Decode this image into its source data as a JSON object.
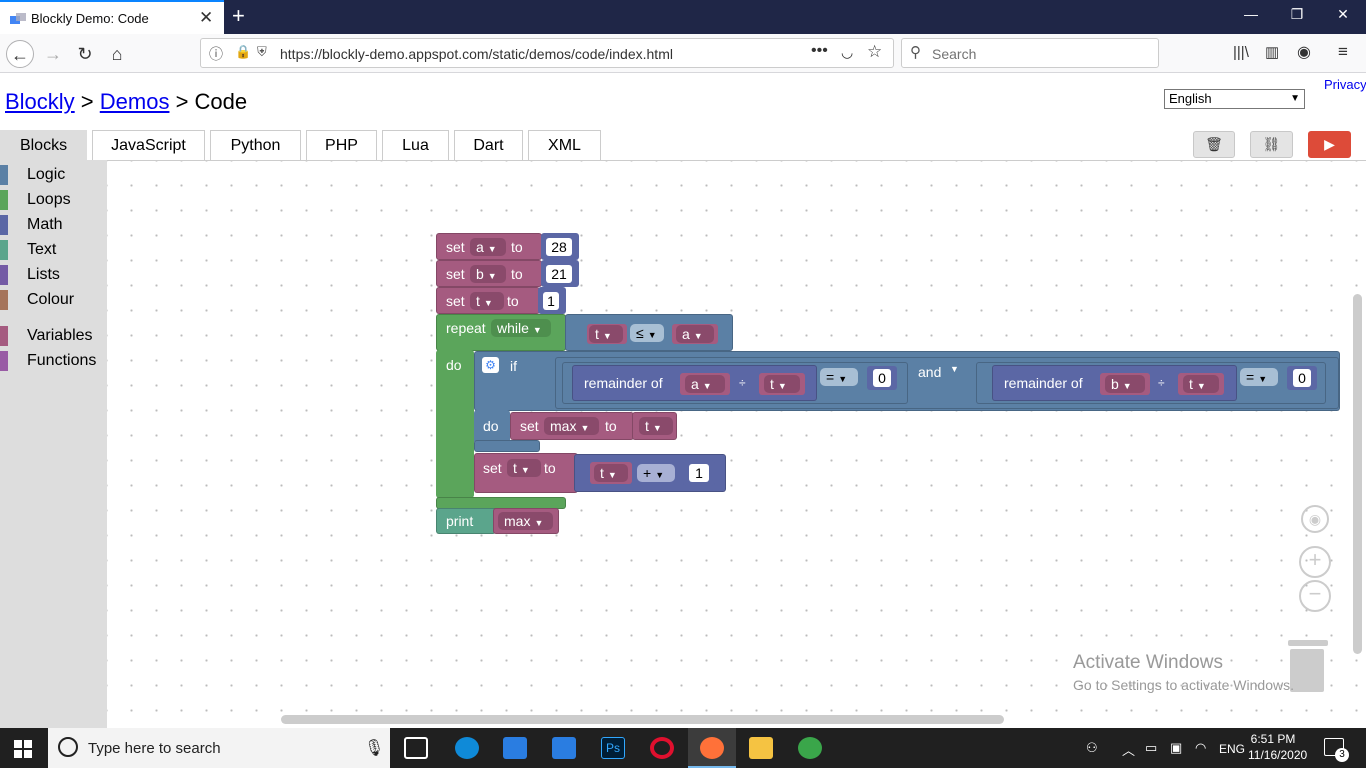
{
  "browser": {
    "tab_title": "Blockly Demo: Code",
    "url": "https://blockly-demo.appspot.com/static/demos/code/index.html",
    "search_placeholder": "Search"
  },
  "header": {
    "breadcrumb_blockly": "Blockly",
    "sep1": " > ",
    "breadcrumb_demos": "Demos",
    "sep2": " > ",
    "breadcrumb_current": "Code",
    "privacy": "Privacy",
    "language": "English"
  },
  "tabs": [
    "Blocks",
    "JavaScript",
    "Python",
    "PHP",
    "Lua",
    "Dart",
    "XML"
  ],
  "toolbox": [
    {
      "label": "Logic",
      "color": "#5b80a5"
    },
    {
      "label": "Loops",
      "color": "#5ba55b"
    },
    {
      "label": "Math",
      "color": "#5b67a5"
    },
    {
      "label": "Text",
      "color": "#5ba58c"
    },
    {
      "label": "Lists",
      "color": "#745ba5"
    },
    {
      "label": "Colour",
      "color": "#a5745b"
    },
    {
      "label": "Variables",
      "color": "#a55b80"
    },
    {
      "label": "Functions",
      "color": "#995ba5"
    }
  ],
  "blocks": {
    "set": "set",
    "to": "to",
    "var_a": "a",
    "var_b": "b",
    "var_t": "t",
    "var_max": "max",
    "val_28": "28",
    "val_21": "21",
    "val_1": "1",
    "val_0": "0",
    "repeat": "repeat",
    "while": "while",
    "lte": "≤",
    "do": "do",
    "if": "if",
    "remainder_of": "remainder of",
    "divide": "÷",
    "equals": "=",
    "and": "and",
    "plus": "+",
    "print": "print"
  },
  "watermark": {
    "line1": "Activate Windows",
    "line2": "Go to Settings to activate Windows."
  },
  "taskbar": {
    "search_placeholder": "Type here to search",
    "lang": "ENG",
    "time": "6:51 PM",
    "date": "11/16/2020",
    "notifications": "3"
  }
}
